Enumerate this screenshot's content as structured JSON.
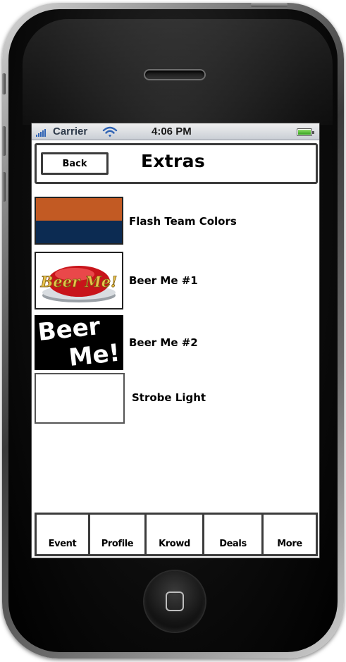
{
  "status_bar": {
    "carrier": "Carrier",
    "time": "4:06 PM",
    "signal_icon": "signal-bars-icon",
    "wifi_icon": "wifi-icon",
    "battery_icon": "battery-icon"
  },
  "nav": {
    "back_label": "Back",
    "title": "Extras"
  },
  "items": [
    {
      "label": "Flash Team Colors",
      "thumb": "team-colors-swatch",
      "colors": [
        "#c25a23",
        "#0c2b52"
      ]
    },
    {
      "label": "Beer Me #1",
      "thumb": "beer-me-button-image",
      "thumb_text": "Beer Me!"
    },
    {
      "label": "Beer Me #2",
      "thumb": "beer-me-text-image",
      "thumb_text_line1": "Beer",
      "thumb_text_line2": "Me!"
    },
    {
      "label": "Strobe Light",
      "thumb": "blank-white-swatch"
    }
  ],
  "tabs": [
    {
      "label": "Event"
    },
    {
      "label": "Profile"
    },
    {
      "label": "Krowd"
    },
    {
      "label": "Deals"
    },
    {
      "label": "More"
    }
  ],
  "colors": {
    "signal_blue": "#2d62b4",
    "battery_green": "#3cae22",
    "outline": "#3c3c3c"
  }
}
